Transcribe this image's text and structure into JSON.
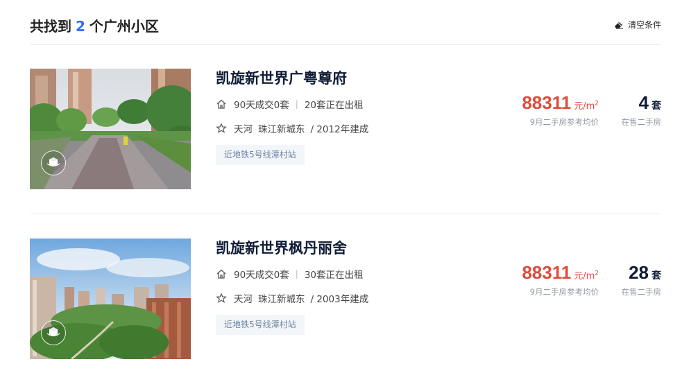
{
  "header": {
    "prefix": "共找到",
    "count": "2",
    "suffix": "个广州小区",
    "clear_label": "清空条件"
  },
  "listings": [
    {
      "title": "凯旋新世界广粤尊府",
      "deals": "90天成交0套",
      "rent": "20套正在出租",
      "district": "天河",
      "area": "珠江新城东",
      "year": "/ 2012年建成",
      "tag": "近地铁5号线潭村站",
      "price": "88311",
      "price_unit": "元/m",
      "price_sup": "2",
      "price_label": "9月二手房参考均价",
      "on_sale": "4",
      "on_sale_unit": "套",
      "on_sale_label": "在售二手房"
    },
    {
      "title": "凯旋新世界枫丹丽舍",
      "deals": "90天成交0套",
      "rent": "30套正在出租",
      "district": "天河",
      "area": "珠江新城东",
      "year": "/ 2003年建成",
      "tag": "近地铁5号线潭村站",
      "price": "88311",
      "price_unit": "元/m",
      "price_sup": "2",
      "price_label": "9月二手房参考均价",
      "on_sale": "28",
      "on_sale_unit": "套",
      "on_sale_label": "在售二手房"
    }
  ],
  "colors": {
    "accent_blue": "#3072f6",
    "price_red": "#e04b3b",
    "title_navy": "#101d37",
    "tag_text": "#6e84a6",
    "tag_bg": "#f3f6f9"
  },
  "icons": [
    "eraser-icon",
    "home-icon",
    "star-icon",
    "vr-360-icon"
  ]
}
